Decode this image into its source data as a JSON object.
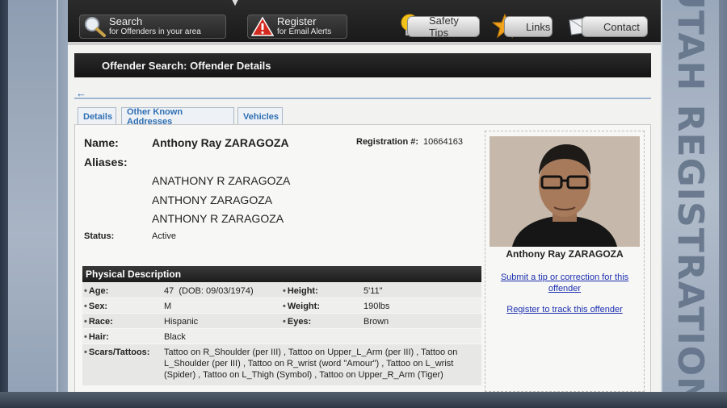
{
  "nav": {
    "search_title": "Search",
    "search_sub": "for Offenders in your area",
    "register_title": "Register",
    "register_sub": "for Email Alerts",
    "safety_tips": "Safety Tips",
    "links": "Links",
    "contact": "Contact"
  },
  "page_title": "Offender Search: Offender Details",
  "back_arrow": "←",
  "tabs": [
    "Details",
    "Other Known Addresses",
    "Vehicles"
  ],
  "offender": {
    "name_label": "Name:",
    "name": "Anthony Ray ZARAGOZA",
    "registration_label": "Registration #:",
    "registration_number": "10664163",
    "aliases_label": "Aliases:",
    "aliases": [
      "ANATHONY R ZARAGOZA",
      "ANTHONY ZARAGOZA",
      "ANTHONY R ZARAGOZA"
    ],
    "status_label": "Status:",
    "status": "Active"
  },
  "photo_panel": {
    "name": "Anthony Ray ZARAGOZA",
    "tip_link": "Submit a tip or correction for this offender",
    "track_link": "Register to track this offender"
  },
  "physical": {
    "header": "Physical Description",
    "age_label": "Age:",
    "age": "47  (DOB: 09/03/1974)",
    "height_label": "Height:",
    "height": "5'11\"",
    "sex_label": "Sex:",
    "sex": "M",
    "weight_label": "Weight:",
    "weight": "190lbs",
    "race_label": "Race:",
    "race": "Hispanic",
    "eyes_label": "Eyes:",
    "eyes": "Brown",
    "hair_label": "Hair:",
    "hair": "Black",
    "scars_label": "Scars/Tattoos:",
    "scars_lines": [
      "Tattoo on R_Shoulder (per III) , Tattoo on Upper_L_Arm (per III) , Tattoo on",
      "L_Shoulder (per III) , Tattoo on R_wrist (word \"Amour\") , Tattoo on L_wrist",
      "(Spider) , Tattoo on L_Thigh (Symbol) , Tattoo on Upper_R_Arm (Tiger)"
    ]
  },
  "frame_text": "UTAH REGISTRATION",
  "colors": {
    "link": "#1b2fb0",
    "tab_text": "#2f6fb3",
    "header_bar": "#1c1c1c",
    "warning_red": "#d42a1f",
    "bulb_yellow": "#f3c21a"
  }
}
